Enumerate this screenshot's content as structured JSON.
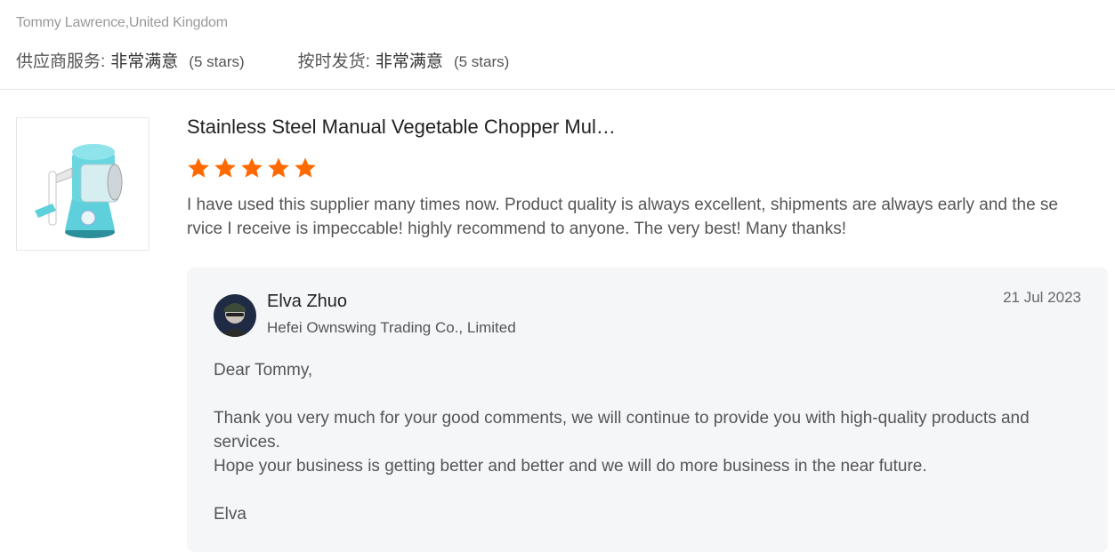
{
  "reviewer": {
    "name_location": "Tommy Lawrence,United Kingdom"
  },
  "ratings": [
    {
      "label": "供应商服务:",
      "value": "非常满意",
      "stars": "(5 stars)"
    },
    {
      "label": "按时发货:",
      "value": "非常满意",
      "stars": "(5 stars)"
    }
  ],
  "product": {
    "image_icon": "vegetable-chopper-image",
    "title": "Stainless Steel Manual Vegetable Chopper Mul…",
    "rating": 5,
    "star_color": "#ff6a00"
  },
  "review": {
    "text": "I have used this supplier many times now. Product quality is always excellent, shipments are always early and the service I receive is impeccable! highly recommend to anyone. The very best! Many thanks!"
  },
  "reply": {
    "name": "Elva Zhuo",
    "company": "Hefei Ownswing Trading Co., Limited",
    "date": "21 Jul 2023",
    "avatar_icon": "avatar",
    "greeting": "Dear Tommy,",
    "line1": "Thank you very much for your good comments, we will continue to provide you with high-quality products and services.",
    "line2": "Hope your business is getting better and better and we will do more business in the near future.",
    "signoff": "Elva"
  }
}
